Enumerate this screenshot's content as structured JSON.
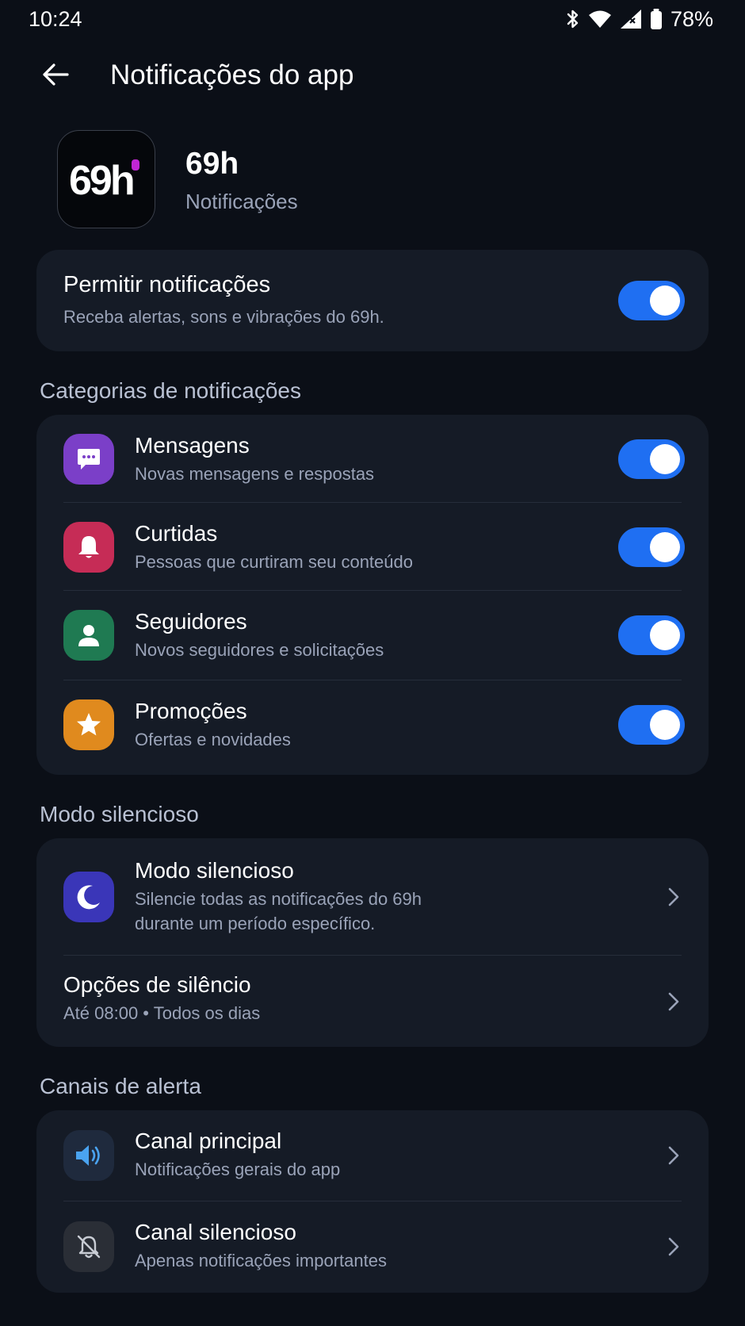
{
  "status_bar": {
    "time": "10:24",
    "battery": "78%",
    "icons": [
      "bluetooth-icon",
      "wifi-icon",
      "cell-signal-icon",
      "battery-icon"
    ]
  },
  "header": {
    "title": "Notificações do app",
    "back_icon": "arrow-back-icon"
  },
  "app": {
    "logo_text": "69h",
    "name": "69h",
    "subtitle": "Notificações",
    "logo_accent_color": "#c026d3"
  },
  "allow": {
    "title": "Permitir notificações",
    "subtitle": "Receba alertas, sons e vibrações do 69h.",
    "enabled": true
  },
  "categories": {
    "section_title": "Categorias de notificações",
    "items": [
      {
        "title": "Mensagens",
        "subtitle": "Novas mensagens e respostas",
        "icon": "chat-bubble-icon",
        "color": "#7b3fc8",
        "enabled": true
      },
      {
        "title": "Curtidas",
        "subtitle": "Pessoas que curtiram seu conteúdo",
        "icon": "bell-icon",
        "color": "#c62c56",
        "enabled": true
      },
      {
        "title": "Seguidores",
        "subtitle": "Novos seguidores e solicitações",
        "icon": "person-icon",
        "color": "#1f7a52",
        "enabled": true
      },
      {
        "title": "Promoções",
        "subtitle": "Ofertas e novidades",
        "icon": "star-icon",
        "color": "#e08a1e",
        "enabled": true
      }
    ]
  },
  "silent": {
    "section_title": "Modo silencioso",
    "mode": {
      "title": "Modo silencioso",
      "subtitle_line1": "Silencie todas as notificações do 69h",
      "subtitle_line2": "durante um período específico.",
      "icon": "moon-icon",
      "color": "#3a36b8"
    },
    "options": {
      "title": "Opções de silêncio",
      "subtitle": "Até 08:00 • Todos os dias"
    }
  },
  "channels": {
    "section_title": "Canais de alerta",
    "items": [
      {
        "title": "Canal principal",
        "subtitle": "Notificações gerais do app",
        "icon": "speaker-icon",
        "color": "#1f2a3d"
      },
      {
        "title": "Canal silencioso",
        "subtitle": "Apenas notificações importantes",
        "icon": "bell-off-icon",
        "color": "#2a2e36"
      }
    ]
  },
  "colors": {
    "background": "#0b0f17",
    "card": "#151b26",
    "toggle_on": "#1f6ff2",
    "text_secondary": "#9aa3b8"
  }
}
